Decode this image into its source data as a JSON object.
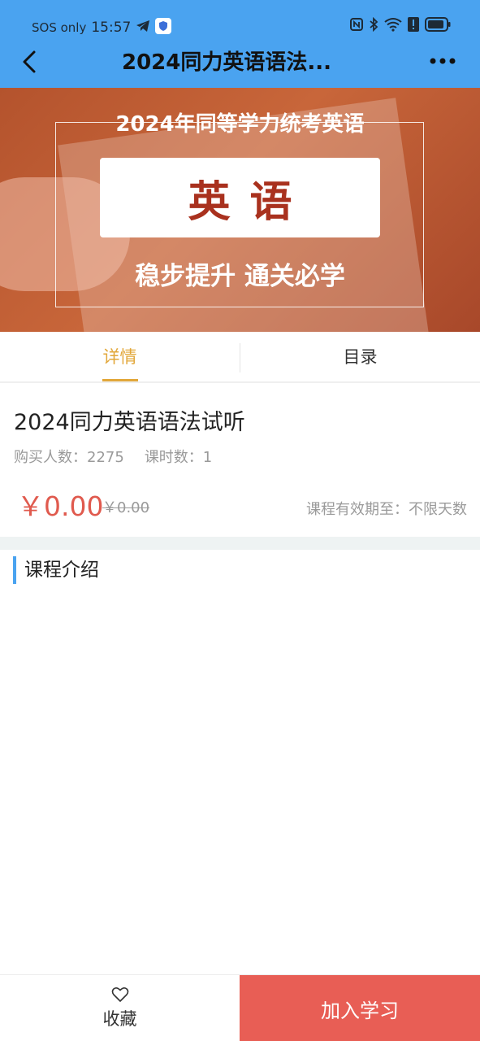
{
  "status_bar": {
    "sos": "SOS only",
    "time": "15:57",
    "icons": [
      "telegram-icon",
      "shield-app-icon",
      "nfc-icon",
      "bluetooth-icon",
      "wifi-icon",
      "alert-icon",
      "battery-icon"
    ]
  },
  "nav": {
    "title": "2024同力英语语法...",
    "back_icon": "chevron-left-icon",
    "more_icon": "more-dots-icon"
  },
  "banner": {
    "top_text": "2024年同等学力统考英语",
    "box_text": "英语",
    "bottom_text": "稳步提升 通关必学"
  },
  "tabs": [
    {
      "label": "详情",
      "active": true
    },
    {
      "label": "目录",
      "active": false
    }
  ],
  "course": {
    "title": "2024同力英语语法试听",
    "buyers_label": "购买人数：2275",
    "lessons_label": "课时数：1",
    "price": "￥0.00",
    "old_price": "￥0.00",
    "validity": "课程有效期至：不限天数"
  },
  "section": {
    "intro_title": "课程介绍"
  },
  "bottom": {
    "favorite_label": "收藏",
    "favorite_icon": "heart-outline-icon",
    "join_label": "加入学习"
  },
  "colors": {
    "header_bg": "#4aa3f0",
    "accent_tab": "#e2a73a",
    "price": "#e05a4e",
    "join_button": "#e85e55"
  }
}
